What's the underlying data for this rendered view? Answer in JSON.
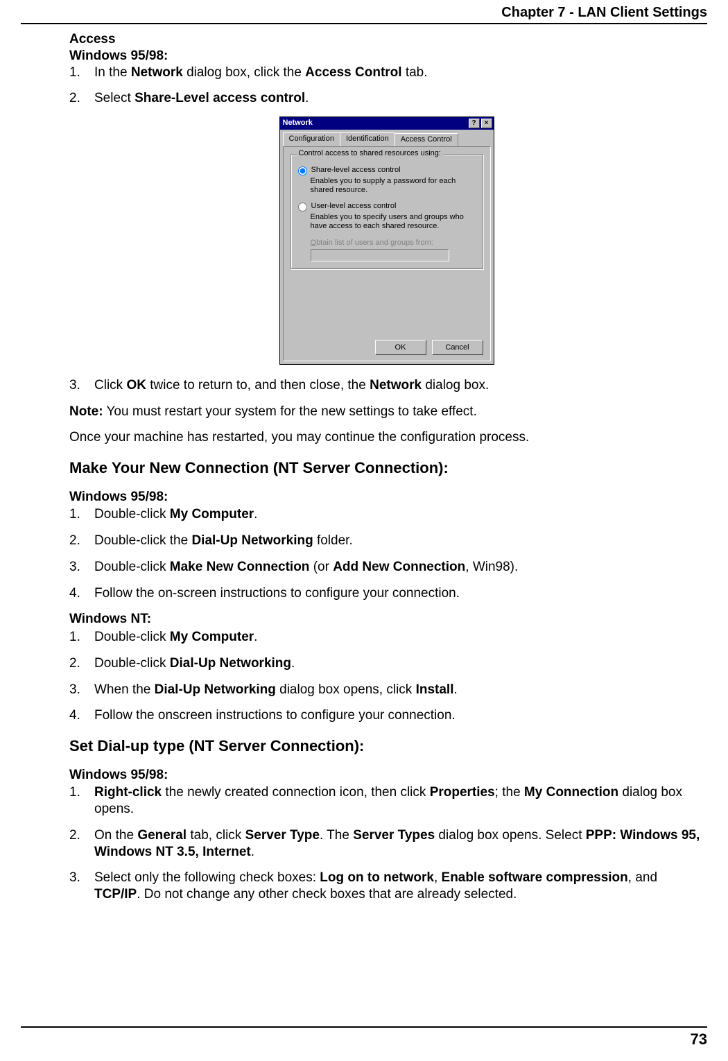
{
  "header": {
    "chapter": "Chapter 7 - LAN Client Settings"
  },
  "section_access": {
    "title": "Access",
    "win95_label": "Windows 95/98:",
    "step1_pre": "In the ",
    "step1_b1": "Network",
    "step1_mid": " dialog box, click the ",
    "step1_b2": "Access Control",
    "step1_post": " tab.",
    "step2_pre": "Select ",
    "step2_b": "Share-Level access control",
    "step2_post": ".",
    "step3_pre": " Click ",
    "step3_b1": "OK",
    "step3_mid": " twice to return to, and then close, the ",
    "step3_b2": "Network",
    "step3_post": " dialog box.",
    "note_label": "Note:",
    "note_text": "  You must restart your system for the new settings to take effect.",
    "restart_text": "Once your machine has restarted, you may continue the configuration process."
  },
  "dialog": {
    "title": "Network",
    "help": "?",
    "close": "×",
    "tab1": "Configuration",
    "tab2": "Identification",
    "tab3": "Access Control",
    "group_title": "Control access to shared resources using:",
    "r1_pre": "S",
    "r1_label": "hare-level access control",
    "r1_desc": "Enables you to supply a password for each shared resource.",
    "r2_pre": "U",
    "r2_label": "ser-level access control",
    "r2_desc": "Enables you to specify users and groups who have access to each shared resource.",
    "obtain_pre": "O",
    "obtain_label": "btain list of users and groups from:",
    "ok": "OK",
    "cancel": "Cancel"
  },
  "section_make": {
    "heading": "Make Your New Connection (NT Server Connection):",
    "win95_label": "Windows 95/98:",
    "a1_pre": "Double-click ",
    "a1_b": "My Computer",
    "a1_post": ".",
    "a2_pre": "Double-click the  ",
    "a2_b": "Dial-Up Networking",
    "a2_post": " folder.",
    "a3_pre": "Double-click ",
    "a3_b1": "Make New Connection",
    "a3_mid": " (or ",
    "a3_b2": "Add New Connection",
    "a3_post": ", Win98).",
    "a4": "Follow the on-screen instructions to configure your connection.",
    "nt_label": "Windows NT:",
    "b1_pre": "Double-click ",
    "b1_b": "My Computer",
    "b1_post": ".",
    "b2_pre": "Double-click ",
    "b2_b": "Dial-Up Networking",
    "b2_post": ".",
    "b3_pre": "When the ",
    "b3_b1": "Dial-Up Networking",
    "b3_mid": " dialog box opens, click ",
    "b3_b2": "Install",
    "b3_post": ".",
    "b4": "Follow the onscreen instructions to configure your connection."
  },
  "section_dialup": {
    "heading": "Set Dial-up type (NT Server Connection):",
    "win95_label": "Windows 95/98:",
    "c1_b1": "Right-click",
    "c1_mid": " the newly created connection icon, then click ",
    "c1_b2": "Properties",
    "c1_mid2": "; the ",
    "c1_b3": "My Connection",
    "c1_post": " dialog box opens.",
    "c2_pre": "On the ",
    "c2_b1": "General",
    "c2_mid": " tab, click ",
    "c2_b2": "Server Type",
    "c2_mid2": ".  The ",
    "c2_b3": "Server Types",
    "c2_mid3": " dialog box opens. Select ",
    "c2_b4": "PPP: Windows 95, Windows NT 3.5, Internet",
    "c2_post": ".",
    "c3_pre": "Select only the following check boxes: ",
    "c3_b1": "Log on to network",
    "c3_c1": ", ",
    "c3_b2": "Enable software compression",
    "c3_c2": ", and ",
    "c3_b3": "TCP/IP",
    "c3_post": ". Do not change any other check boxes that are already selected."
  },
  "nums": {
    "n1": "1.",
    "n2": "2.",
    "n3": "3.",
    "n4": "4."
  },
  "footer": {
    "page": "73"
  }
}
